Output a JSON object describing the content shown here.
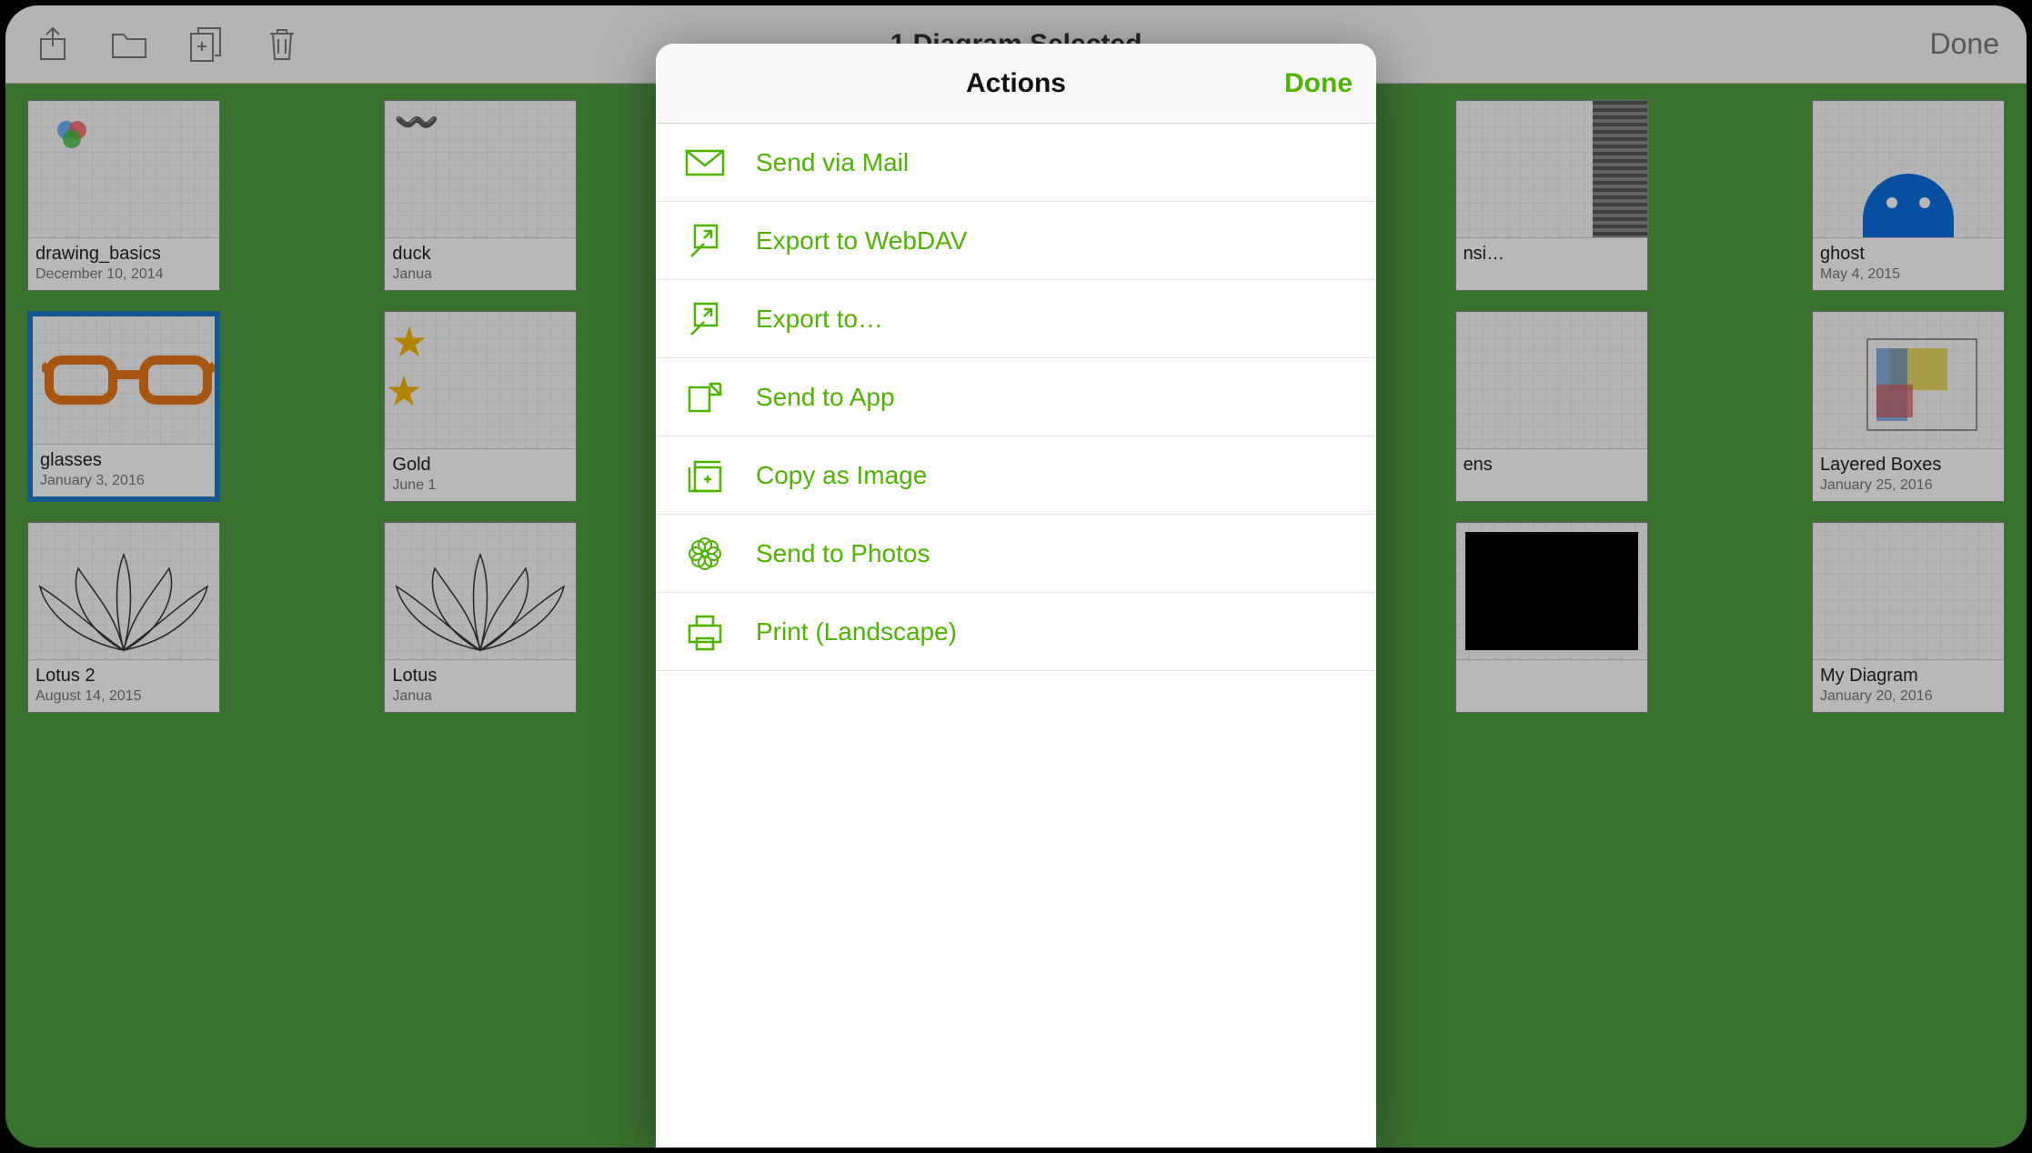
{
  "colors": {
    "accent": "#4fb400",
    "selection": "#1e78c8",
    "background": "#4f9f42"
  },
  "toolbar": {
    "title": "1 Diagram Selected",
    "done_label": "Done",
    "icons": {
      "share": "share-icon",
      "folder": "folder-icon",
      "duplicate": "duplicate-icon",
      "trash": "trash-icon"
    }
  },
  "popover": {
    "title": "Actions",
    "done_label": "Done",
    "items": [
      {
        "icon": "mail-icon",
        "label": "Send via Mail"
      },
      {
        "icon": "export-icon",
        "label": "Export to WebDAV"
      },
      {
        "icon": "export-icon",
        "label": "Export to…"
      },
      {
        "icon": "send-app-icon",
        "label": "Send to App"
      },
      {
        "icon": "copy-image-icon",
        "label": "Copy as Image"
      },
      {
        "icon": "photos-icon",
        "label": "Send to Photos"
      },
      {
        "icon": "print-icon",
        "label": "Print (Landscape)"
      }
    ]
  },
  "grid": {
    "items": [
      {
        "name": "drawing_basics",
        "date": "December 10, 2014",
        "thumb": "venn",
        "selected": false
      },
      {
        "name": "duck",
        "date": "Janua",
        "thumb": "duck",
        "selected": false
      },
      {
        "name": "",
        "date": "",
        "thumb": "blank",
        "selected": false
      },
      {
        "name": "",
        "date": "",
        "thumb": "blank",
        "selected": false
      },
      {
        "name": "nsi…",
        "date": "",
        "thumb": "nsi",
        "selected": false
      },
      {
        "name": "ghost",
        "date": "May 4, 2015",
        "thumb": "ghost",
        "selected": false
      },
      {
        "name": "glasses",
        "date": "January 3, 2016",
        "thumb": "glasses",
        "selected": true
      },
      {
        "name": "Gold",
        "date": "June 1",
        "thumb": "stars",
        "selected": false
      },
      {
        "name": "",
        "date": "",
        "thumb": "blank",
        "selected": false
      },
      {
        "name": "",
        "date": "",
        "thumb": "blank",
        "selected": false
      },
      {
        "name": "ens",
        "date": "",
        "thumb": "blank",
        "selected": false
      },
      {
        "name": "Layered Boxes",
        "date": "January 25, 2016",
        "thumb": "boxes",
        "selected": false
      },
      {
        "name": "Lotus 2",
        "date": "August 14, 2015",
        "thumb": "lotus",
        "selected": false
      },
      {
        "name": "Lotus",
        "date": "Janua",
        "thumb": "lotus",
        "selected": false
      },
      {
        "name": "",
        "date": "",
        "thumb": "blank",
        "selected": false
      },
      {
        "name": "",
        "date": "",
        "thumb": "blank",
        "selected": false
      },
      {
        "name": "",
        "date": "",
        "thumb": "black",
        "selected": false
      },
      {
        "name": "My Diagram",
        "date": "January 20, 2016",
        "thumb": "blank",
        "selected": false
      }
    ]
  }
}
